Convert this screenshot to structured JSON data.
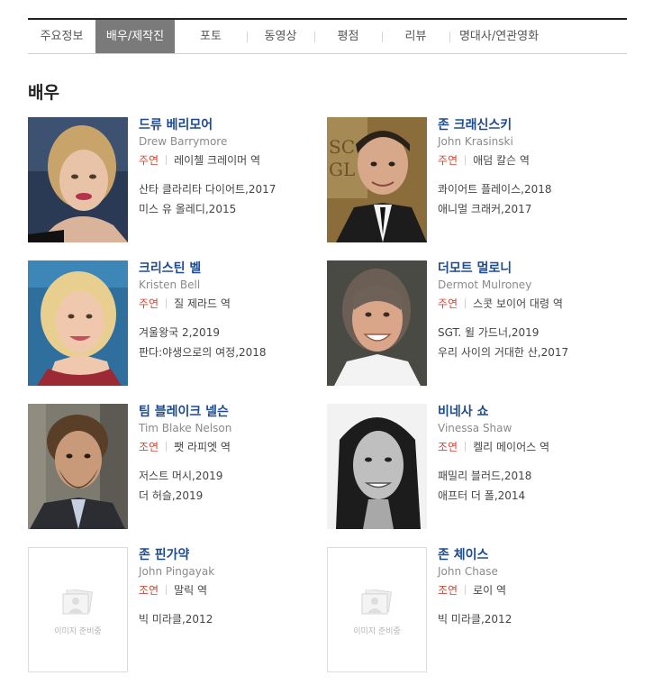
{
  "tabs": [
    {
      "label": "주요정보",
      "active": false
    },
    {
      "label": "배우/제작진",
      "active": true
    },
    {
      "label": "포토",
      "active": false
    },
    {
      "label": "동영상",
      "active": false
    },
    {
      "label": "평점",
      "active": false
    },
    {
      "label": "리뷰",
      "active": false
    },
    {
      "label": "명대사/연관영화",
      "active": false
    }
  ],
  "section_title": "배우",
  "actors": [
    {
      "name": "드류 베리모어",
      "english_name": "Drew Barrymore",
      "role_type": "주연",
      "role": "레이첼 크레이머 역",
      "films": [
        "산타 클라리타 다이어트,2017",
        "미스 유 올레디,2015"
      ]
    },
    {
      "name": "존 크래신스키",
      "english_name": "John Krasinski",
      "role_type": "주연",
      "role": "애덤 칼슨 역",
      "films": [
        "콰이어트 플레이스,2018",
        "애니멀 크래커,2017"
      ]
    },
    {
      "name": "크리스틴 벨",
      "english_name": "Kristen Bell",
      "role_type": "주연",
      "role": "질 제라드 역",
      "films": [
        "겨울왕국 2,2019",
        "판다:야생으로의 여정,2018"
      ]
    },
    {
      "name": "더모트 멀로니",
      "english_name": "Dermot Mulroney",
      "role_type": "주연",
      "role": "스콧 보이어 대령 역",
      "films": [
        "SGT. 윌 가드너,2019",
        "우리 사이의 거대한 산,2017"
      ]
    },
    {
      "name": "팀 블레이크 넬슨",
      "english_name": "Tim Blake Nelson",
      "role_type": "조연",
      "role": "팻 라피엣 역",
      "films": [
        "저스트 머시,2019",
        "더 허슬,2019"
      ]
    },
    {
      "name": "비네사 쇼",
      "english_name": "Vinessa Shaw",
      "role_type": "조연",
      "role": "켈리 메이어스 역",
      "films": [
        "패밀리 블러드,2018",
        "애프터 더 폴,2014"
      ]
    },
    {
      "name": "존 핀가약",
      "english_name": "John Pingayak",
      "role_type": "조연",
      "role": "말릭 역",
      "films": [
        "빅 미라클,2012"
      ],
      "placeholder_text": "이미지 준비중"
    },
    {
      "name": "존 체이스",
      "english_name": "John Chase",
      "role_type": "조연",
      "role": "로이 역",
      "films": [
        "빅 미라클,2012"
      ],
      "placeholder_text": "이미지 준비중"
    }
  ],
  "colors": {
    "name": "#1d4b8f",
    "role_type": "#d24836",
    "active_tab": "#7a7a7a"
  }
}
